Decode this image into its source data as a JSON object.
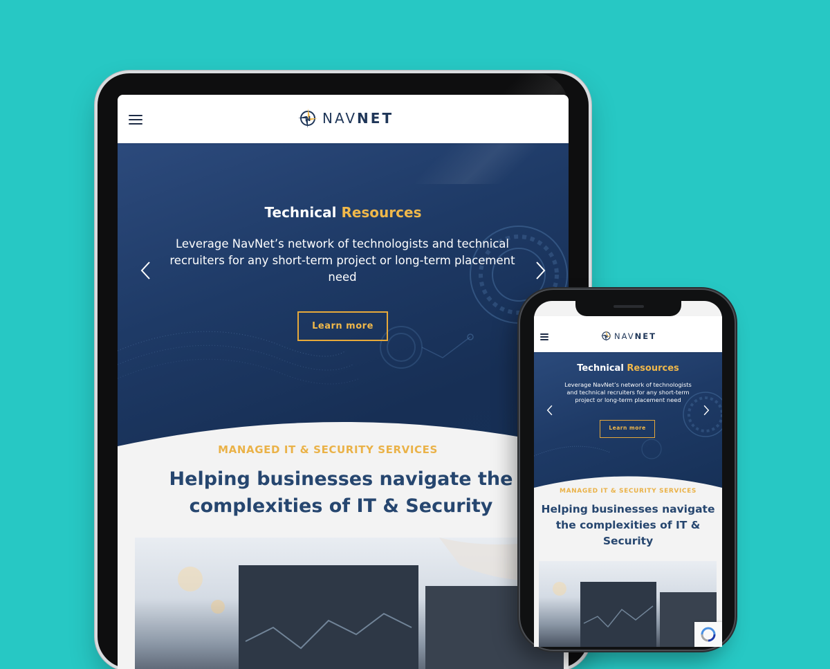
{
  "brand": {
    "logo_nav": "NAV",
    "logo_net": "NET",
    "accent_color": "#f0b84a",
    "navy_color": "#1f3658"
  },
  "hero": {
    "title_main": "Technical",
    "title_accent": "Resources",
    "description": "Leverage NavNet’s network of technologists and technical recruiters for any short-term project or long-term placement need",
    "button_label": "Learn more"
  },
  "section": {
    "eyebrow": "MANAGED IT & SECURITY SERVICES",
    "heading": "Helping businesses navigate the complexities of IT & Security"
  },
  "icons": {
    "menu": "hamburger-menu-icon",
    "prev": "chevron-left-icon",
    "next": "chevron-right-icon",
    "captcha": "recaptcha-icon"
  }
}
